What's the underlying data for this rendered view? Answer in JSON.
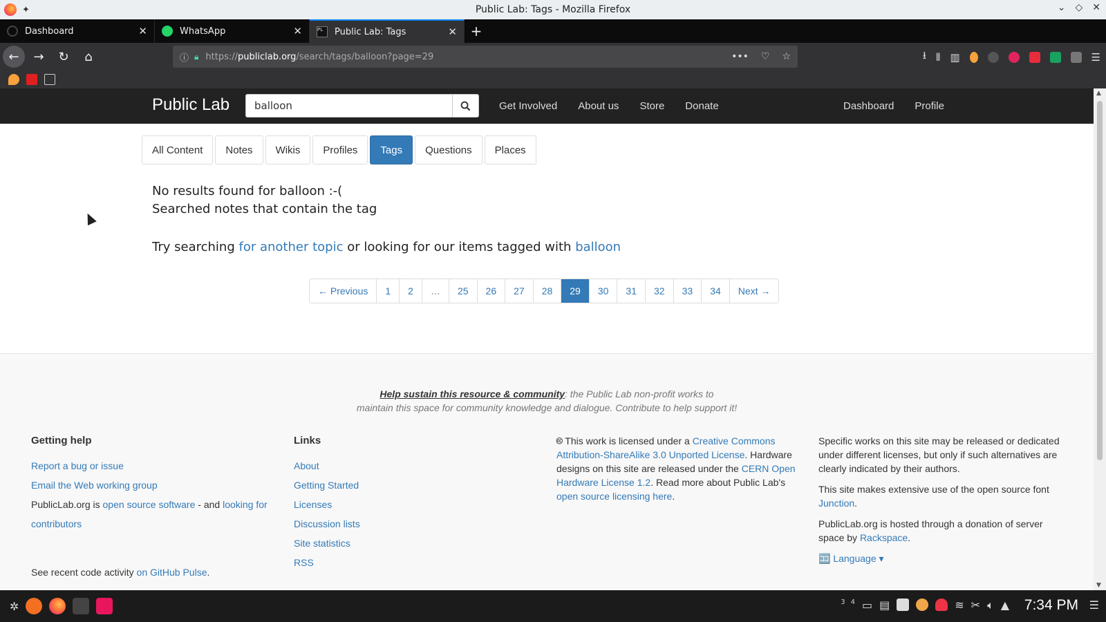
{
  "window": {
    "title": "Public Lab: Tags - Mozilla Firefox"
  },
  "tabs": [
    {
      "label": "Dashboard"
    },
    {
      "label": "WhatsApp"
    },
    {
      "label": "Public Lab: Tags"
    }
  ],
  "urlbar": {
    "prefix": "https://",
    "host": "publiclab.org",
    "path": "/search/tags/balloon?page=29"
  },
  "site": {
    "brand": "Public Lab",
    "search_value": "balloon",
    "nav_left": [
      "Get Involved",
      "About us",
      "Store",
      "Donate"
    ],
    "nav_right": [
      "Dashboard",
      "Profile"
    ]
  },
  "content_tabs": [
    "All Content",
    "Notes",
    "Wikis",
    "Profiles",
    "Tags",
    "Questions",
    "Places"
  ],
  "active_tab": "Tags",
  "results": {
    "line1": "No results found for balloon :-(",
    "line2": "Searched notes that contain the tag",
    "try_prefix": "Try searching ",
    "try_link1": "for another topic",
    "try_mid": " or looking for our items tagged with ",
    "try_link2": "balloon"
  },
  "pagination": {
    "prev": "← Previous",
    "pages": [
      "1",
      "2",
      "…",
      "25",
      "26",
      "27",
      "28",
      "29",
      "30",
      "31",
      "32",
      "33",
      "34"
    ],
    "current": "29",
    "next": "Next →"
  },
  "footer": {
    "sustain_bold": "Help sustain this resource & community",
    "sustain_rest1": ": the Public Lab non-profit works to",
    "sustain_rest2": "maintain this space for community knowledge and dialogue. Contribute to help support it!",
    "help": {
      "heading": "Getting help",
      "link1": "Report a bug or issue",
      "link2": "Email the Web working group",
      "oss_prefix": "PublicLab.org is ",
      "oss_link": "open source software",
      "oss_mid": " - and ",
      "oss_link2": "looking for contributors",
      "github_prefix": "See recent code activity ",
      "github_link": "on GitHub Pulse",
      "github_suffix": "."
    },
    "links": {
      "heading": "Links",
      "items": [
        "About",
        "Getting Started",
        "Licenses",
        "Discussion lists",
        "Site statistics",
        "RSS"
      ]
    },
    "license": {
      "t1": "This work is licensed under a ",
      "l1": "Creative Commons Attribution-ShareAlike 3.0 Unported License",
      "t2": ". Hardware designs on this site are released under the ",
      "l2": "CERN Open Hardware License 1.2",
      "t3": ". Read more about Public Lab's ",
      "l3": "open source licensing here",
      "t4": "."
    },
    "specific": {
      "p1": "Specific works on this site may be released or dedicated under different licenses, but only if such alternatives are clearly indicated by their authors.",
      "p2_prefix": "This site makes extensive use of the open source font ",
      "p2_link": "Junction",
      "p2_suffix": ".",
      "p3_prefix": "PublicLab.org is hosted through a donation of server space by ",
      "p3_link": "Rackspace",
      "p3_suffix": ".",
      "language": "Language"
    }
  },
  "taskbar": {
    "clock": "7:34 PM",
    "workspace_a": "3",
    "workspace_b": "4"
  },
  "colors": {
    "link": "#337ab7",
    "header_bg": "#222222",
    "active_tab": "#337ab7"
  }
}
